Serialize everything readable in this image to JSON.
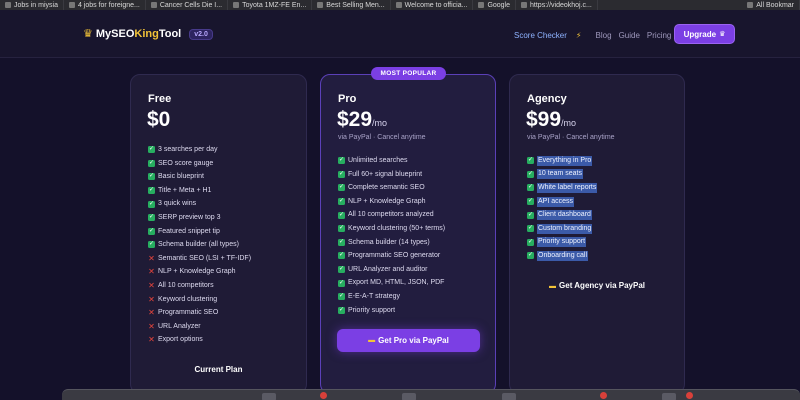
{
  "bookmarks": [
    {
      "label": "Jobs in miysia"
    },
    {
      "label": "4 jobs for foreigne..."
    },
    {
      "label": "Cancer Cells Die I..."
    },
    {
      "label": "Toyota 1MZ-FE En..."
    },
    {
      "label": "Best Selling Men..."
    },
    {
      "label": "Welcome to officia..."
    },
    {
      "label": "Google"
    },
    {
      "label": "https://videokhoj.c..."
    },
    {
      "label": "All Bookmar"
    }
  ],
  "nav": {
    "brand_prefix": "MySEO",
    "brand_king": "King",
    "brand_suffix": "Tool",
    "version": "v2.0",
    "links": [
      {
        "label": "Score Checker",
        "active": true,
        "icon": "bolt-icon"
      },
      {
        "label": "Blog"
      },
      {
        "label": "Guide"
      },
      {
        "label": "Pricing"
      }
    ],
    "upgrade_label": "Upgrade",
    "crown_icon": "crown-icon"
  },
  "badge": "MOST POPULAR",
  "plans": {
    "free": {
      "name": "Free",
      "price": "$0",
      "features": [
        {
          "text": "3 searches per day",
          "included": true
        },
        {
          "text": "SEO score gauge",
          "included": true
        },
        {
          "text": "Basic blueprint",
          "included": true
        },
        {
          "text": "Title + Meta + H1",
          "included": true
        },
        {
          "text": "3 quick wins",
          "included": true
        },
        {
          "text": "SERP preview top 3",
          "included": true
        },
        {
          "text": "Featured snippet tip",
          "included": true
        },
        {
          "text": "Schema builder (all types)",
          "included": true
        },
        {
          "text": "Semantic SEO (LSI + TF-IDF)",
          "included": false
        },
        {
          "text": "NLP + Knowledge Graph",
          "included": false
        },
        {
          "text": "All 10 competitors",
          "included": false
        },
        {
          "text": "Keyword clustering",
          "included": false
        },
        {
          "text": "Programmatic SEO",
          "included": false
        },
        {
          "text": "URL Analyzer",
          "included": false
        },
        {
          "text": "Export options",
          "included": false
        }
      ],
      "cta": "Current Plan"
    },
    "pro": {
      "name": "Pro",
      "price": "$29",
      "period": "/mo",
      "subtitle": "via PayPal · Cancel anytime",
      "features": [
        {
          "text": "Unlimited searches",
          "included": true
        },
        {
          "text": "Full 60+ signal blueprint",
          "included": true
        },
        {
          "text": "Complete semantic SEO",
          "included": true
        },
        {
          "text": "NLP + Knowledge Graph",
          "included": true
        },
        {
          "text": "All 10 competitors analyzed",
          "included": true
        },
        {
          "text": "Keyword clustering (50+ terms)",
          "included": true
        },
        {
          "text": "Schema builder (14 types)",
          "included": true
        },
        {
          "text": "Programmatic SEO generator",
          "included": true
        },
        {
          "text": "URL Analyzer and auditor",
          "included": true
        },
        {
          "text": "Export MD, HTML, JSON, PDF",
          "included": true
        },
        {
          "text": "E-E-A-T strategy",
          "included": true
        },
        {
          "text": "Priority support",
          "included": true
        }
      ],
      "cta": "Get Pro via PayPal"
    },
    "agency": {
      "name": "Agency",
      "price": "$99",
      "period": "/mo",
      "subtitle": "via PayPal · Cancel anytime",
      "features": [
        {
          "text": "Everything in Pro",
          "included": true
        },
        {
          "text": "10 team seats",
          "included": true
        },
        {
          "text": "White label reports",
          "included": true
        },
        {
          "text": "API access",
          "included": true
        },
        {
          "text": "Client dashboard",
          "included": true
        },
        {
          "text": "Custom branding",
          "included": true
        },
        {
          "text": "Priority support",
          "included": true
        },
        {
          "text": "Onboarding call",
          "included": true
        }
      ],
      "cta": "Get Agency via PayPal"
    }
  },
  "colors": {
    "background": "#14112a",
    "accent": "#7b3fe4",
    "check": "#27ae60",
    "cross": "#e8453c",
    "gold": "#f2c338"
  }
}
